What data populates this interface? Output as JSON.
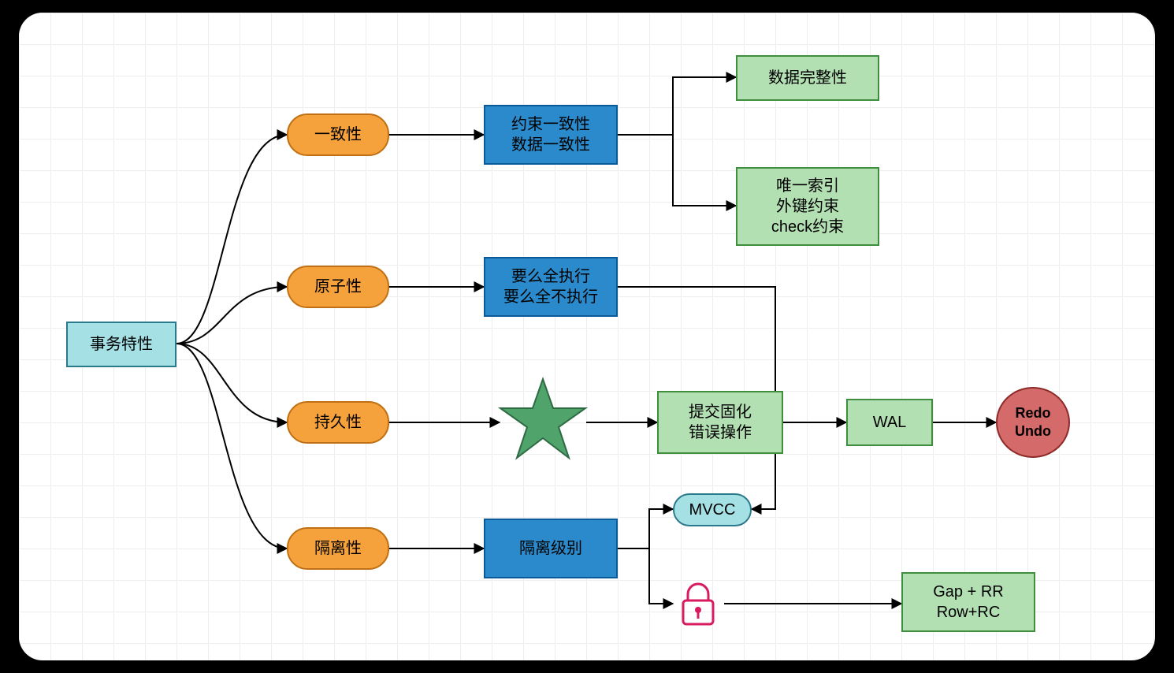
{
  "nodes": {
    "root": "事务特性",
    "consistency": "一致性",
    "atomicity": "原子性",
    "durability": "持久性",
    "isolation": "隔离性",
    "consistency_detail_line1": "约束一致性",
    "consistency_detail_line2": "数据一致性",
    "atomicity_detail_line1": "要么全执行",
    "atomicity_detail_line2": "要么全不执行",
    "durability_detail_line1": "提交固化",
    "durability_detail_line2": "错误操作",
    "isolation_detail": "隔离级别",
    "data_integrity": "数据完整性",
    "constraints_line1": "唯一索引",
    "constraints_line2": "外键约束",
    "constraints_line3": "check约束",
    "wal": "WAL",
    "redo_undo_line1": "Redo",
    "redo_undo_line2": "Undo",
    "mvcc": "MVCC",
    "locks_line1": "Gap + RR",
    "locks_line2": "Row+RC"
  }
}
